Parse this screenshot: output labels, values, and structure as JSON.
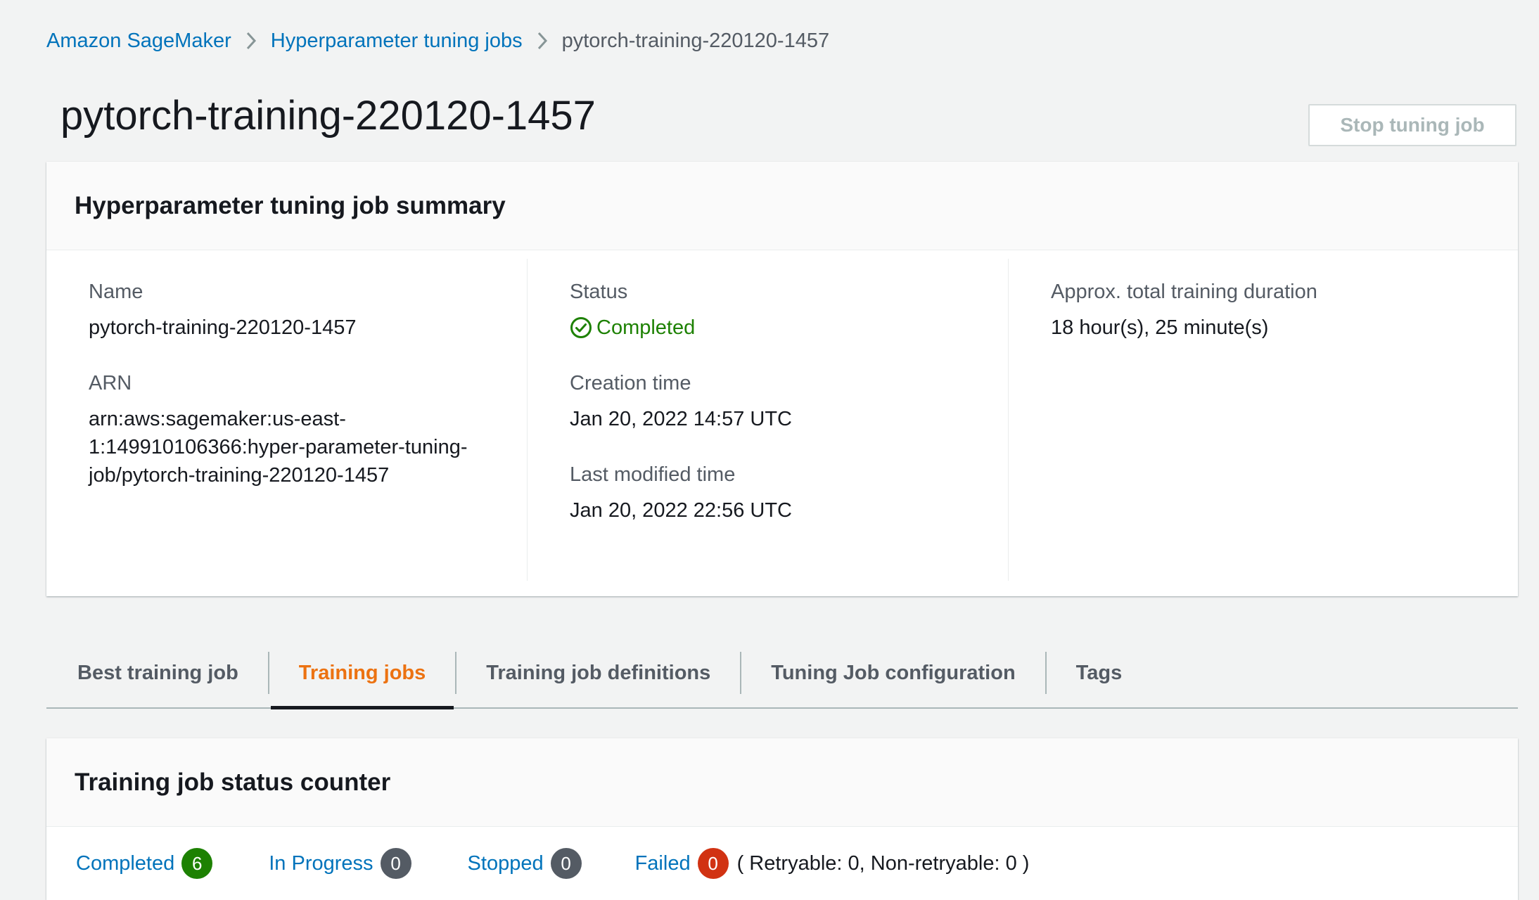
{
  "breadcrumb": {
    "items": [
      {
        "label": "Amazon SageMaker",
        "link": true
      },
      {
        "label": "Hyperparameter tuning jobs",
        "link": true
      },
      {
        "label": "pytorch-training-220120-1457",
        "link": false
      }
    ]
  },
  "header": {
    "title": "pytorch-training-220120-1457",
    "stop_button_label": "Stop tuning job"
  },
  "summary": {
    "title": "Hyperparameter tuning job summary",
    "name_label": "Name",
    "name_value": "pytorch-training-220120-1457",
    "arn_label": "ARN",
    "arn_lines": [
      "arn:aws:sagemaker:us-east-",
      "1:149910106366:hyper-parameter-tuning-",
      "job/pytorch-training-220120-1457"
    ],
    "status_label": "Status",
    "status_value": "Completed",
    "creation_label": "Creation time",
    "creation_value": "Jan 20, 2022 14:57 UTC",
    "modified_label": "Last modified time",
    "modified_value": "Jan 20, 2022 22:56 UTC",
    "duration_label": "Approx. total training duration",
    "duration_value": "18 hour(s), 25 minute(s)"
  },
  "tabs": [
    {
      "label": "Best training job",
      "active": false
    },
    {
      "label": "Training jobs",
      "active": true
    },
    {
      "label": "Training job definitions",
      "active": false
    },
    {
      "label": "Tuning Job configuration",
      "active": false
    },
    {
      "label": "Tags",
      "active": false
    }
  ],
  "counter": {
    "title": "Training job status counter",
    "items": [
      {
        "label": "Completed",
        "count": "6",
        "color": "#1d8102"
      },
      {
        "label": "In Progress",
        "count": "0",
        "color": "#545b64"
      },
      {
        "label": "Stopped",
        "count": "0",
        "color": "#545b64"
      },
      {
        "label": "Failed",
        "count": "0",
        "color": "#d13212"
      }
    ],
    "retry_note": "( Retryable: 0, Non-retryable: 0 )"
  },
  "colors": {
    "link": "#0073bb",
    "active_tab": "#ec7211",
    "success": "#1d8102",
    "error": "#d13212"
  }
}
